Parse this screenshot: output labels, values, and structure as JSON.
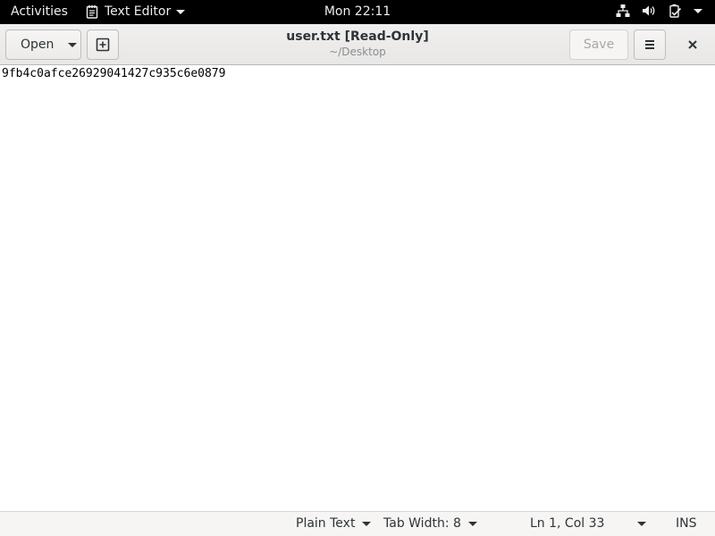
{
  "topbar": {
    "activities_label": "Activities",
    "app_name": "Text Editor",
    "clock": "Mon 22:11",
    "status_icons": [
      "network-icon",
      "volume-icon",
      "battery-icon",
      "power-menu-caret"
    ]
  },
  "headerbar": {
    "open_label": "Open",
    "title": "user.txt [Read-Only]",
    "subtitle": "~/Desktop",
    "save_label": "Save"
  },
  "editor": {
    "lines": [
      "9fb4c0afce26929041427c935c6e0879"
    ]
  },
  "statusbar": {
    "language": "Plain Text",
    "tab_width": "Tab Width: 8",
    "cursor_position": "Ln 1, Col 33",
    "insert_mode": "INS"
  },
  "colors": {
    "topbar_bg": "#000000",
    "headerbar_bg": "#e8e7e6",
    "editor_bg": "#ffffff",
    "statusbar_bg": "#f6f5f4"
  }
}
